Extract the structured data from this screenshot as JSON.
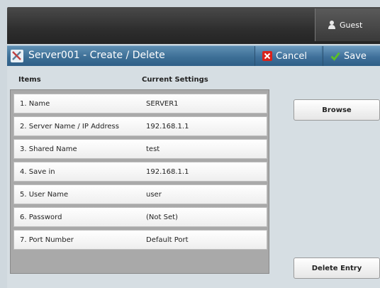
{
  "header": {
    "guest_label": "Guest"
  },
  "titlebar": {
    "title": "Server001 - Create / Delete",
    "cancel_label": "Cancel",
    "save_label": "Save"
  },
  "table": {
    "col_items": "Items",
    "col_current": "Current Settings",
    "rows": [
      {
        "label": "1. Name",
        "value": "SERVER1"
      },
      {
        "label": "2. Server Name / IP Address",
        "value": "192.168.1.1"
      },
      {
        "label": "3. Shared Name",
        "value": "test"
      },
      {
        "label": "4. Save in",
        "value": "192.168.1.1"
      },
      {
        "label": "5. User Name",
        "value": "user"
      },
      {
        "label": "6. Password",
        "value": "(Not Set)"
      },
      {
        "label": "7. Port Number",
        "value": "Default Port"
      }
    ]
  },
  "side": {
    "browse_label": "Browse",
    "delete_label": "Delete Entry"
  },
  "colors": {
    "titlebar": "#3d6f96",
    "cancel_icon": "#d9221c",
    "save_icon": "#5bbf2a"
  },
  "icons": {
    "title": "tools-icon",
    "guest": "user-icon",
    "cancel": "x-icon",
    "save": "checkmark-icon"
  }
}
